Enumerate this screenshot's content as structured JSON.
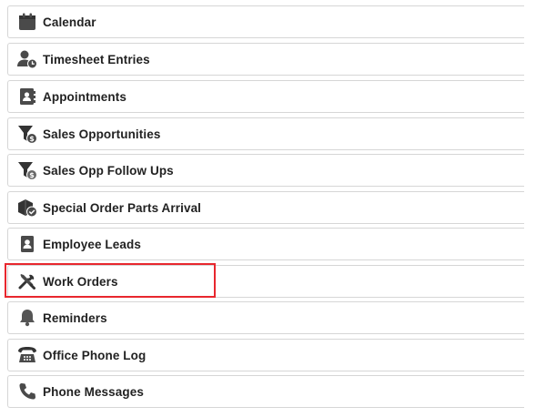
{
  "menu": {
    "items": [
      {
        "label": "Calendar",
        "icon": "calendar-icon"
      },
      {
        "label": "Timesheet Entries",
        "icon": "user-clock-icon"
      },
      {
        "label": "Appointments",
        "icon": "address-book-icon"
      },
      {
        "label": "Sales Opportunities",
        "icon": "funnel-dollar-icon"
      },
      {
        "label": "Sales Opp Follow Ups",
        "icon": "funnel-dollar-icon"
      },
      {
        "label": "Special Order Parts Arrival",
        "icon": "box-check-icon"
      },
      {
        "label": "Employee Leads",
        "icon": "id-badge-icon"
      },
      {
        "label": "Work Orders",
        "icon": "tools-icon"
      },
      {
        "label": "Reminders",
        "icon": "bell-icon"
      },
      {
        "label": "Office Phone Log",
        "icon": "office-phone-icon"
      },
      {
        "label": "Phone Messages",
        "icon": "phone-icon"
      }
    ],
    "highlighted_item": "Work Orders"
  },
  "colors": {
    "icon": "#4a4a4a",
    "text": "#222222",
    "border": "#d6d6d6",
    "highlight": "#e8272e"
  }
}
